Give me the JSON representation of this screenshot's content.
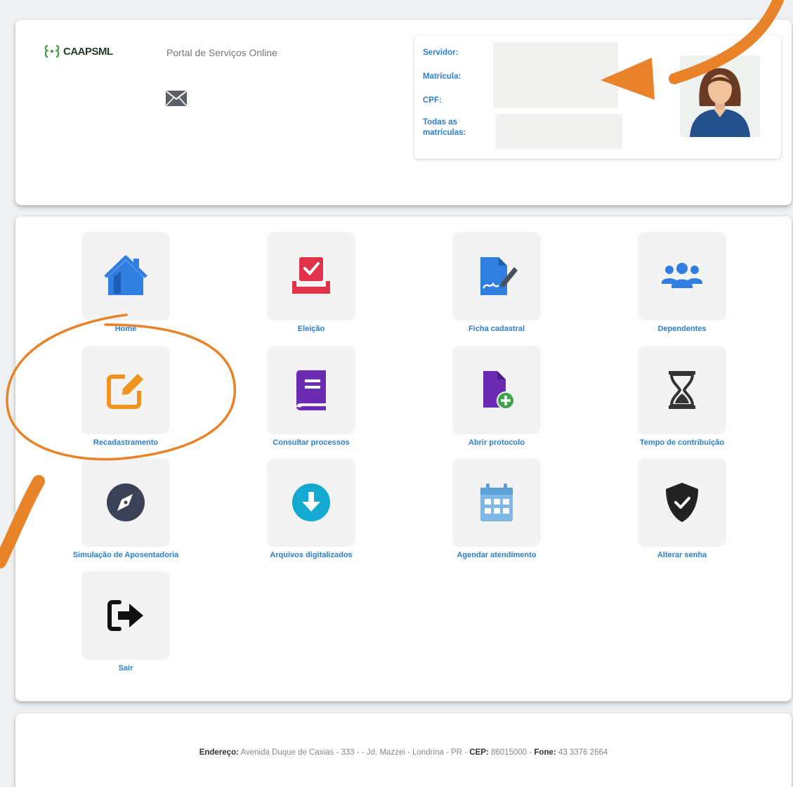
{
  "header": {
    "logo_text": "CAAPSML",
    "portal_title": "Portal de Serviços Online",
    "user_info": {
      "servidor_label": "Servidor:",
      "matricula_label": "Matrícula:",
      "cpf_label": "CPF:",
      "todas_label_line1": "Todas as",
      "todas_label_line2": "matrículas:"
    }
  },
  "menu": {
    "items": [
      {
        "label": "Home",
        "icon": "home-icon",
        "color": "#2f7ee0"
      },
      {
        "label": "Eleição",
        "icon": "ballot-icon",
        "color": "#e0324b"
      },
      {
        "label": "Ficha cadastral",
        "icon": "file-signature-icon",
        "color": "#2f7ee0"
      },
      {
        "label": "Dependentes",
        "icon": "users-icon",
        "color": "#2f7ee0"
      },
      {
        "label": "Recadastramento",
        "icon": "edit-icon",
        "color": "#f0941e"
      },
      {
        "label": "Consultar processos",
        "icon": "book-icon",
        "color": "#6c2bb3"
      },
      {
        "label": "Abrir protocolo",
        "icon": "file-plus-icon",
        "color": "#6c2bb3"
      },
      {
        "label": "Tempo de contribuição",
        "icon": "hourglass-icon",
        "color": "#333333"
      },
      {
        "label": "Simulação de Aposentadoria",
        "icon": "compass-icon",
        "color": "#3b4257"
      },
      {
        "label": "Arquivos digitalizados",
        "icon": "download-circle-icon",
        "color": "#14a9d1"
      },
      {
        "label": "Agendar atendimento",
        "icon": "calendar-icon",
        "color": "#7fb8e6"
      },
      {
        "label": "Alterar senha",
        "icon": "shield-check-icon",
        "color": "#222222"
      },
      {
        "label": "Sair",
        "icon": "sign-out-icon",
        "color": "#111111"
      }
    ]
  },
  "footer": {
    "endereco_label": "Endereço:",
    "endereco_value": "Avenida Duque de Caxias - 333 - - Jd. Mazzei - Londrina - PR -",
    "cep_label": "CEP:",
    "cep_value": "86015000 -",
    "fone_label": "Fone:",
    "fone_value": "43 3376 2664"
  },
  "colors": {
    "label_blue": "#2a7fd1",
    "annotation_orange": "#e8832a"
  }
}
